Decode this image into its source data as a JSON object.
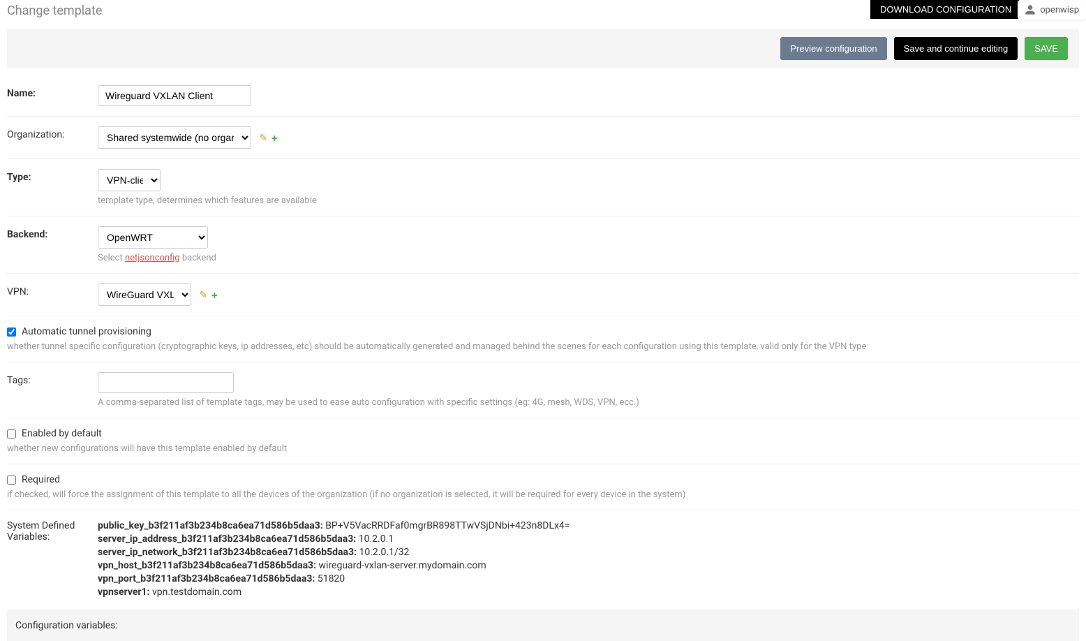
{
  "header": {
    "title": "Change template",
    "download_btn": "DOWNLOAD CONFIGURATION",
    "username": "openwisp"
  },
  "actions": {
    "preview": "Preview configuration",
    "save_continue": "Save and continue editing",
    "save": "SAVE"
  },
  "fields": {
    "name": {
      "label": "Name:",
      "value": "Wireguard VXLAN Client"
    },
    "organization": {
      "label": "Organization:",
      "selected": "Shared systemwide (no organization)"
    },
    "type": {
      "label": "Type:",
      "selected": "VPN-client",
      "help": "template type, determines which features are available"
    },
    "backend": {
      "label": "Backend:",
      "selected": "OpenWRT",
      "help_prefix": "Select ",
      "help_link": "netjsonconfig",
      "help_suffix": " backend"
    },
    "vpn": {
      "label": "VPN:",
      "selected": "WireGuard VXLAN"
    },
    "auto_provisioning": {
      "label": "Automatic tunnel provisioning",
      "checked": true,
      "help": "whether tunnel specific configuration (cryptographic keys, ip addresses, etc) should be automatically generated and managed behind the scenes for each configuration using this template, valid only for the VPN type"
    },
    "tags": {
      "label": "Tags:",
      "help": "A comma-separated list of template tags, may be used to ease auto configuration with specific settings (eg: 4G, mesh, WDS, VPN, ecc.)"
    },
    "enabled_default": {
      "label": "Enabled by default",
      "checked": false,
      "help": "whether new configurations will have this template enabled by default"
    },
    "required": {
      "label": "Required",
      "checked": false,
      "help": "if checked, will force the assignment of this template to all the devices of the organization (if no organization is selected, it will be required for every device in the system)"
    },
    "sys_vars": {
      "label": "System Defined Variables:",
      "items": [
        {
          "key": "public_key_b3f211af3b234b8ca6ea71d586b5daa3:",
          "val": "BP+V5VacRRDFaf0mgrBR898TTwVSjDNbi+423n8DLx4="
        },
        {
          "key": "server_ip_address_b3f211af3b234b8ca6ea71d586b5daa3:",
          "val": "10.2.0.1"
        },
        {
          "key": "server_ip_network_b3f211af3b234b8ca6ea71d586b5daa3:",
          "val": "10.2.0.1/32"
        },
        {
          "key": "vpn_host_b3f211af3b234b8ca6ea71d586b5daa3:",
          "val": "wireguard-vxlan-server.mydomain.com"
        },
        {
          "key": "vpn_port_b3f211af3b234b8ca6ea71d586b5daa3:",
          "val": "51820"
        },
        {
          "key": "vpnserver1:",
          "val": "vpn.testdomain.com"
        }
      ]
    },
    "config_vars": {
      "label": "Configuration variables:"
    }
  }
}
